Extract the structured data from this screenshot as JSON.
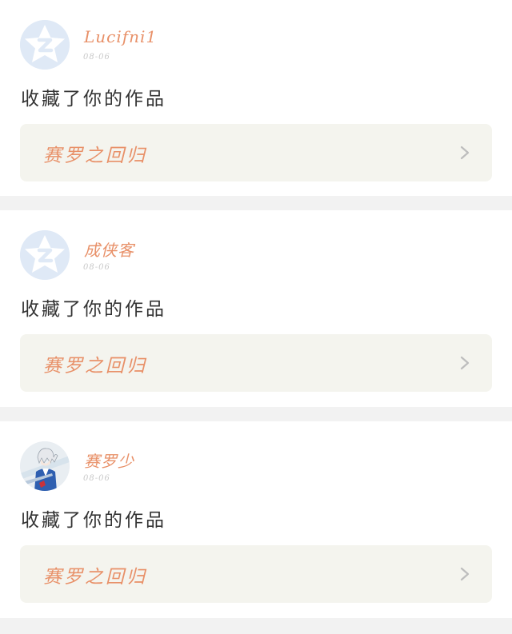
{
  "feed": {
    "items": [
      {
        "user": "Lucifni1",
        "avatar_icon": "qq-default-avatar-icon",
        "date": "08-06",
        "action": "收藏了你的作品",
        "work_title": "赛罗之回归",
        "chevron_icon": "chevron-right-icon"
      },
      {
        "user": "成侠客",
        "avatar_icon": "qq-default-avatar-icon",
        "date": "08-06",
        "action": "收藏了你的作品",
        "work_title": "赛罗之回归",
        "chevron_icon": "chevron-right-icon"
      },
      {
        "user": "赛罗少",
        "avatar_icon": "anime-character-avatar",
        "date": "08-06",
        "action": "收藏了你的作品",
        "work_title": "赛罗之回归",
        "chevron_icon": "chevron-right-icon"
      }
    ]
  },
  "colors": {
    "accent": "#e89068",
    "page_bg": "#f2f2f2",
    "card_bg": "#ffffff",
    "link_bg": "#f4f4ee",
    "date": "#c8c8c8",
    "text": "#333333",
    "default_avatar_bg": "#dfe9f6"
  }
}
